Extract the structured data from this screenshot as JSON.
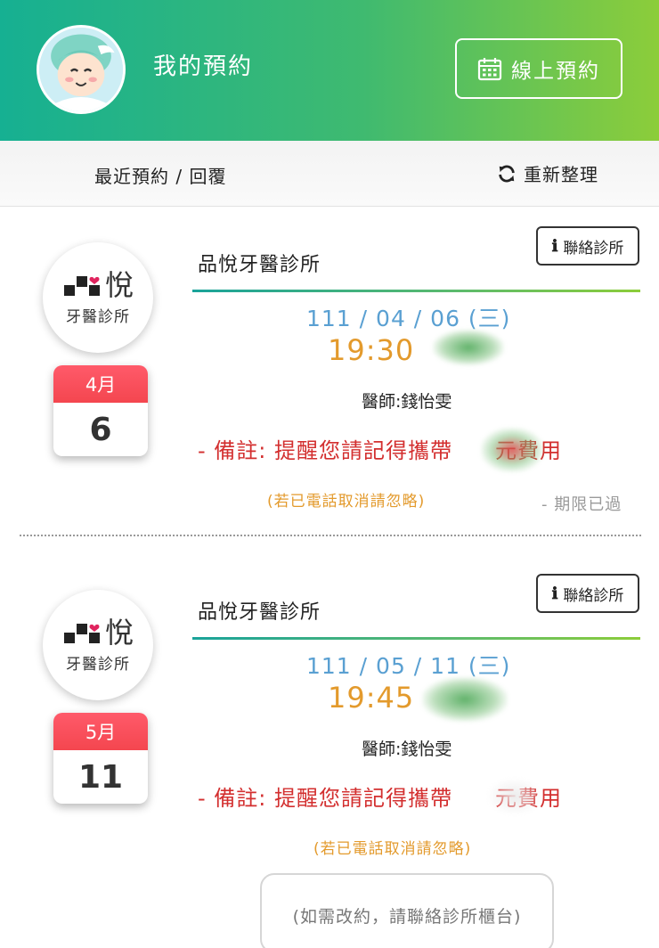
{
  "header": {
    "title": "我的預約",
    "booking_button": "線上預約",
    "accent_gradient": [
      "#16b092",
      "#8ccd3a"
    ]
  },
  "subbar": {
    "recent_label": "最近預約 / 回覆",
    "refresh_label": "重新整理"
  },
  "appointments": [
    {
      "logo_big": "悅",
      "logo_sub": "牙醫診所",
      "month": "4月",
      "day": "6",
      "clinic": "品悅牙醫診所",
      "contact": "聯絡診所",
      "date": "111 / 04 / 06 (三)",
      "time": "19:30",
      "doctor": "醫師:錢怡雯",
      "note_a": "- 備註: 提醒您請記得攜帶",
      "note_b": "元費用",
      "cancel_hint": "(若已電話取消請忽略)",
      "status": "- 期限已過"
    },
    {
      "logo_big": "悅",
      "logo_sub": "牙醫診所",
      "month": "5月",
      "day": "11",
      "clinic": "品悅牙醫診所",
      "contact": "聯絡診所",
      "date": "111 / 05 / 11 (三)",
      "time": "19:45",
      "doctor": "醫師:錢怡雯",
      "note_a": "- 備註: 提醒您請記得攜帶",
      "note_b": "元費用",
      "cancel_hint": "(若已電話取消請忽略)"
    }
  ],
  "footer": {
    "reschedule_hint": "(如需改約，請聯絡診所櫃台)"
  },
  "colors": {
    "date_blue": "#5aa0d2",
    "time_orange": "#e39a2c",
    "note_red": "#d32f2f",
    "calendar_red": "#f4464f"
  },
  "icons": [
    "calendar-icon",
    "refresh-icon",
    "info-icon",
    "clinic-logo-mark",
    "heart-icon"
  ]
}
